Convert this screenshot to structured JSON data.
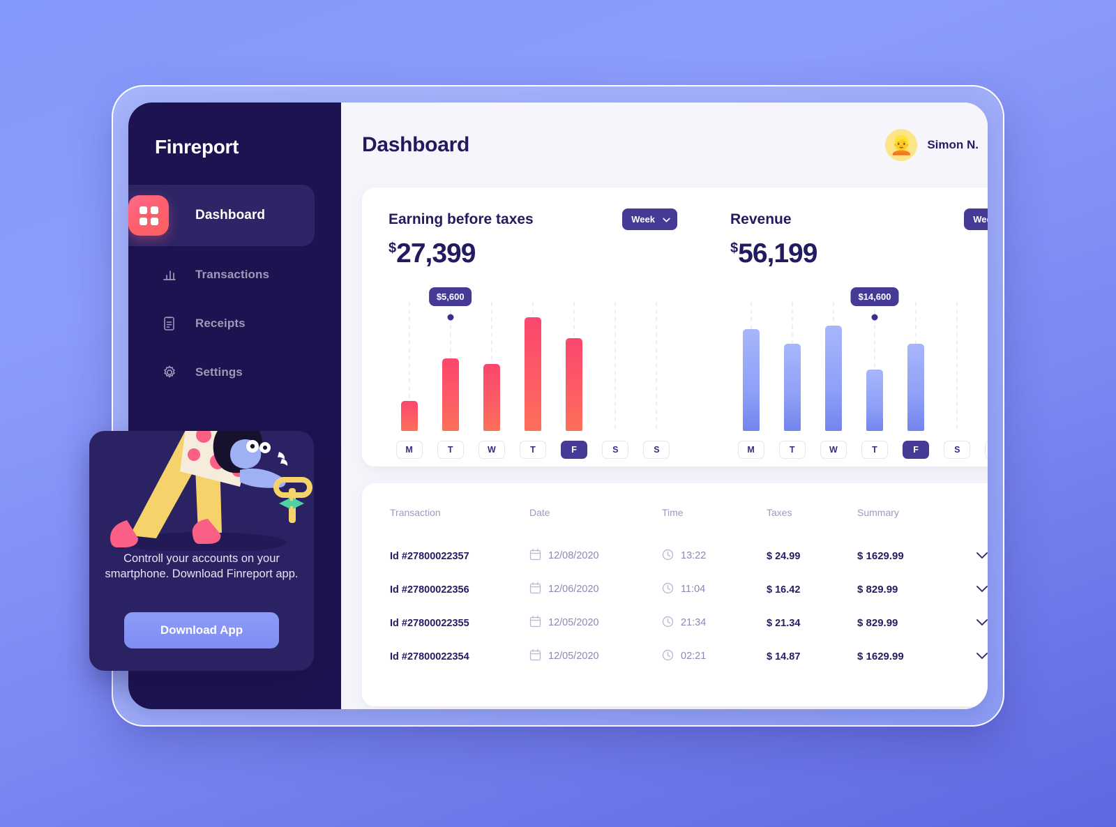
{
  "brand": "Finreport",
  "sidebar": {
    "items": [
      {
        "label": "Dashboard",
        "icon": "grid-icon",
        "active": true
      },
      {
        "label": "Transactions",
        "icon": "bar-chart-icon",
        "active": false
      },
      {
        "label": "Receipts",
        "icon": "clipboard-icon",
        "active": false
      },
      {
        "label": "Settings",
        "icon": "gear-icon",
        "active": false
      }
    ]
  },
  "promo": {
    "text": "Controll your accounts on your smartphone. Download Finreport app.",
    "button_label": "Download App"
  },
  "header": {
    "title": "Dashboard",
    "user_name": "Simon N.",
    "avatar_glyph": "👱",
    "chevron_icon": "chevron-down-icon",
    "bell_icon": "bell-icon",
    "has_notification": true
  },
  "chart_data": [
    {
      "type": "bar",
      "title": "Earning before taxes",
      "currency_symbol": "$",
      "total": "27,399",
      "range_label": "Week",
      "categories": [
        "M",
        "T",
        "W",
        "T",
        "F",
        "S",
        "S"
      ],
      "values": [
        2300,
        5600,
        5200,
        8800,
        7200,
        0,
        0
      ],
      "selected_category_index": 4,
      "tooltip": {
        "label": "$5,600",
        "category_index": 1
      },
      "color": "#fb466f",
      "ylim": [
        0,
        10000
      ],
      "grid": true,
      "xlabel": "",
      "ylabel": ""
    },
    {
      "type": "bar",
      "title": "Revenue",
      "currency_symbol": "$",
      "total": "56,199",
      "range_label": "Week",
      "categories": [
        "M",
        "T",
        "W",
        "T",
        "F",
        "S",
        "S"
      ],
      "values": [
        12600,
        10800,
        13100,
        7600,
        10800,
        0,
        0
      ],
      "selected_category_index": 4,
      "tooltip": {
        "label": "$14,600",
        "category_index": 3
      },
      "color": "#8e9ff7",
      "ylim": [
        0,
        16000
      ],
      "grid": true,
      "xlabel": "",
      "ylabel": ""
    }
  ],
  "table": {
    "columns": [
      "Transaction",
      "Date",
      "Time",
      "Taxes",
      "Summary"
    ],
    "rows": [
      {
        "transaction": "Id #27800022357",
        "date": "12/08/2020",
        "time": "13:22",
        "taxes": "$ 24.99",
        "summary": "$ 1629.99"
      },
      {
        "transaction": "Id #27800022356",
        "date": "12/06/2020",
        "time": "11:04",
        "taxes": "$ 16.42",
        "summary": "$ 829.99"
      },
      {
        "transaction": "Id #27800022355",
        "date": "12/05/2020",
        "time": "21:34",
        "taxes": "$ 21.34",
        "summary": "$ 829.99"
      },
      {
        "transaction": "Id #27800022354",
        "date": "12/05/2020",
        "time": "02:21",
        "taxes": "$ 14.87",
        "summary": "$ 1629.99"
      }
    ],
    "row_icons": {
      "date": "calendar-icon",
      "time": "clock-icon",
      "expand": "chevron-down-icon"
    }
  },
  "colors": {
    "accent_pink": "#fb466f",
    "accent_blue": "#8e9ff7",
    "sidebar_bg": "#1c1350",
    "badge_purple": "#453a96",
    "text_dark": "#231b5f"
  }
}
